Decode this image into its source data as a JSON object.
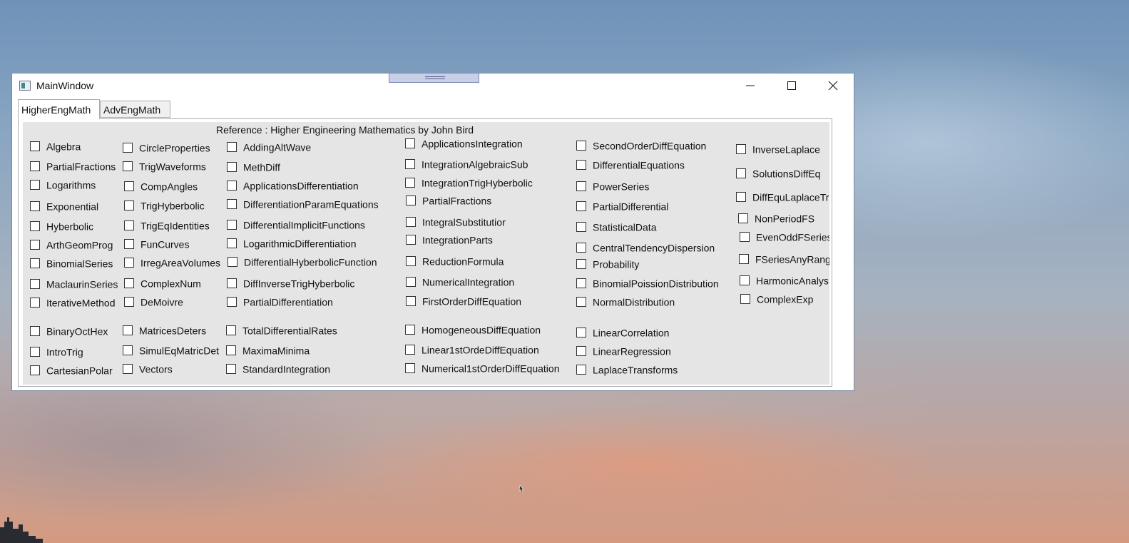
{
  "window": {
    "title": "MainWindow"
  },
  "tabs": [
    {
      "label": "HigherEngMath"
    },
    {
      "label": "AdvEngMath"
    }
  ],
  "reference": "Reference : Higher Engineering Mathematics by John Bird",
  "checkboxes": [
    "Algebra",
    "PartialFractions",
    "Logarithms",
    "Exponential",
    "Hyberbolic",
    "ArthGeomProg",
    "BinomialSeries",
    "MaclaurinSeries",
    "IterativeMethod",
    "BinaryOctHex",
    "IntroTrig",
    "CartesianPolar",
    "CircleProperties",
    "TrigWaveforms",
    "CompAngles",
    "TrigHyberbolic",
    "TrigEqIdentities",
    "FunCurves",
    "IrregAreaVolumes",
    "ComplexNum",
    "DeMoivre",
    "MatricesDeters",
    "SimulEqMatricDet",
    "Vectors",
    "AddingAltWave",
    "MethDiff",
    "ApplicationsDifferentiation",
    "DifferentiationParamEquations",
    "DifferentialImplicitFunctions",
    "LogarithmicDifferentiation",
    "DifferentialHyberbolicFunction",
    "DiffInverseTrigHyberbolic",
    "PartialDifferentiation",
    "TotalDifferentialRates",
    "MaximaMinima",
    "StandardIntegration",
    "ApplicationsIntegration",
    "IntegrationAlgebraicSub",
    "IntegrationTrigHyberbolic",
    "PartialFractions",
    "IntegralSubstitutior",
    "IntegrationParts",
    "ReductionFormula",
    "NumericalIntegration",
    "FirstOrderDiffEquation",
    "HomogeneousDiffEquation",
    "Linear1stOrdeDiffEquation",
    "Numerical1stOrderDiffEquation",
    "SecondOrderDiffEquation",
    "DifferentialEquations",
    "PowerSeries",
    "PartialDifferential",
    "StatisticalData",
    "CentralTendencyDispersion",
    "Probability",
    "BinomialPoissionDistribution",
    "NormalDistribution",
    "LinearCorrelation",
    "LinearRegression",
    "LaplaceTransforms",
    "InverseLaplace",
    "SolutionsDiffEq",
    "DiffEquLaplaceTr",
    "NonPeriodFS",
    "EvenOddFSeries",
    "FSeriesAnyRang",
    "HarmonicAnalys",
    "ComplexExp"
  ],
  "icons": {
    "app": "app-window-icon",
    "minimize": "minimize-icon",
    "maximize": "maximize-icon",
    "close": "close-icon"
  }
}
